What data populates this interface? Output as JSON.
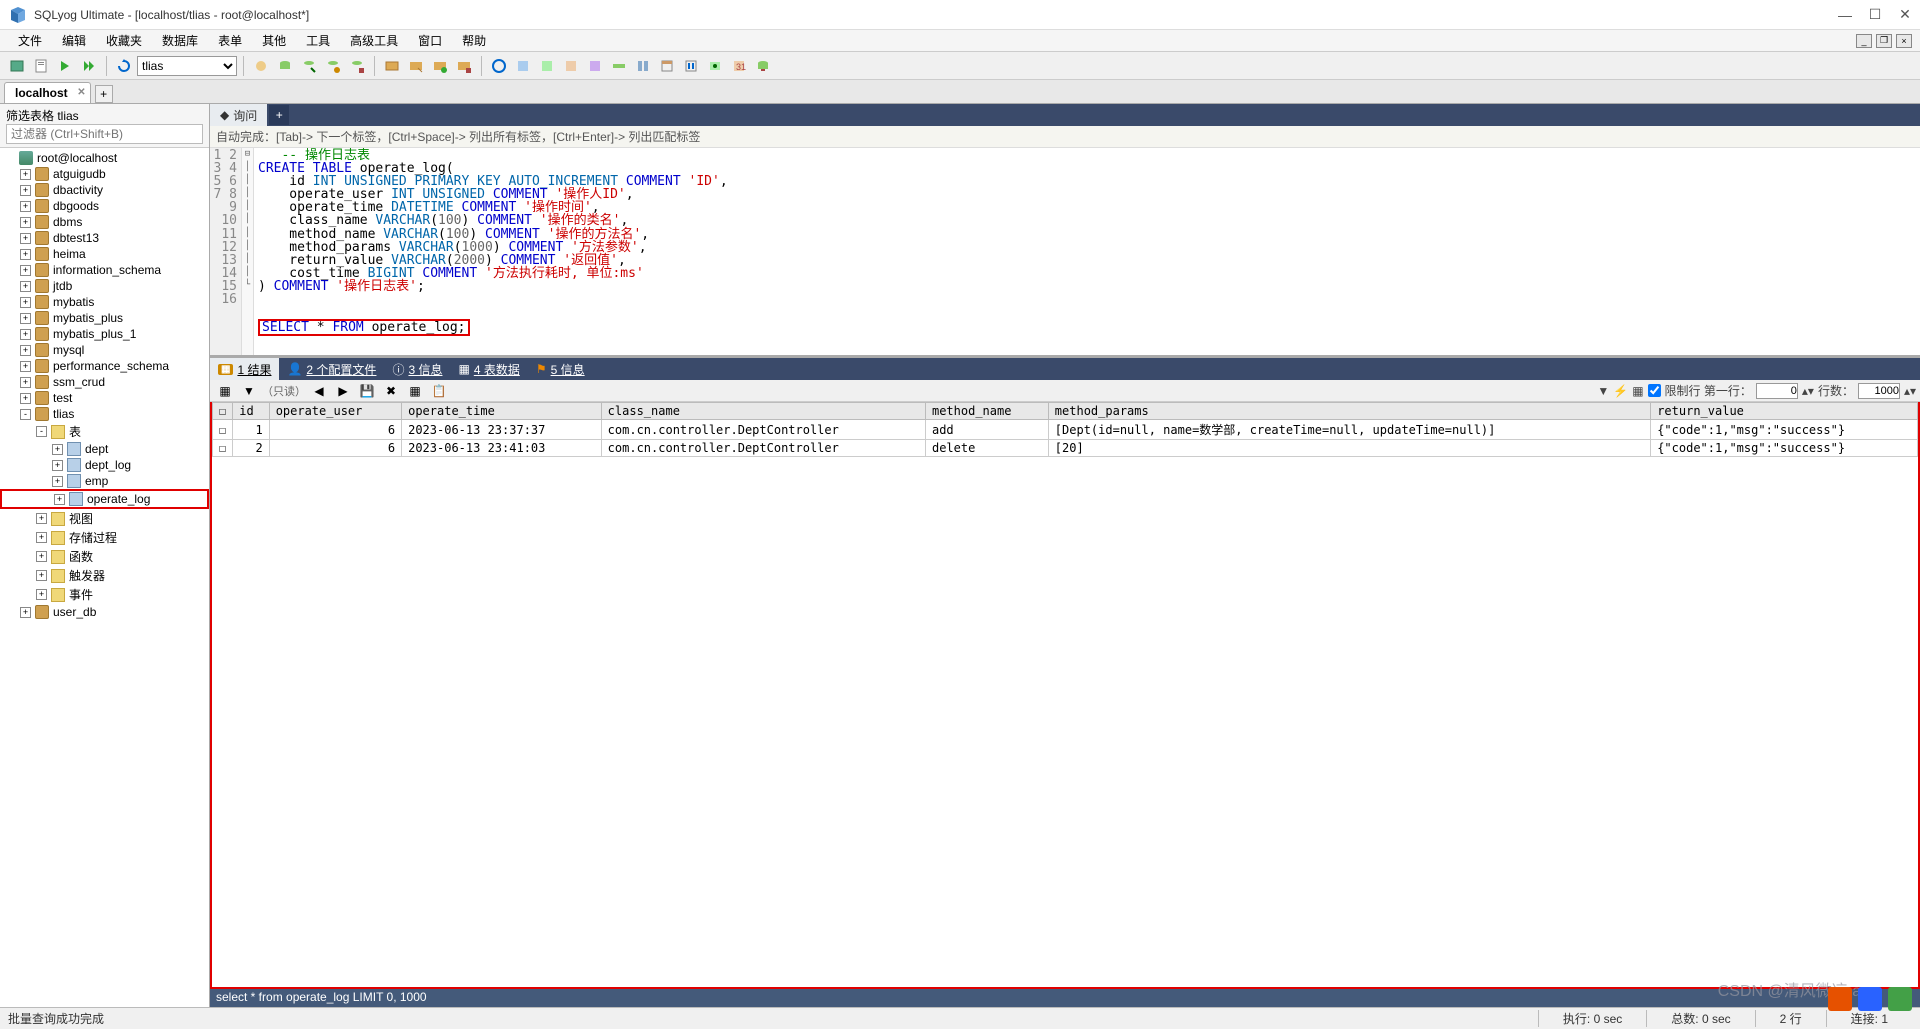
{
  "window": {
    "title": "SQLyog Ultimate - [localhost/tlias - root@localhost*]"
  },
  "menubar": [
    "文件",
    "编辑",
    "收藏夹",
    "数据库",
    "表单",
    "其他",
    "工具",
    "高级工具",
    "窗口",
    "帮助"
  ],
  "toolbar": {
    "db_selected": "tlias"
  },
  "conn_tab": "localhost",
  "sidebar": {
    "filter_label": "筛选表格 tlias",
    "filter_placeholder": "过滤器 (Ctrl+Shift+B)",
    "root": "root@localhost",
    "databases": [
      "atguigudb",
      "dbactivity",
      "dbgoods",
      "dbms",
      "dbtest13",
      "heima",
      "information_schema",
      "jtdb",
      "mybatis",
      "mybatis_plus",
      "mybatis_plus_1",
      "mysql",
      "performance_schema",
      "ssm_crud",
      "test"
    ],
    "current_db": "tlias",
    "tables_label": "表",
    "tables": [
      "dept",
      "dept_log",
      "emp",
      "operate_log"
    ],
    "folders": [
      "视图",
      "存储过程",
      "函数",
      "触发器",
      "事件"
    ],
    "last_db": "user_db"
  },
  "query": {
    "tab_label": "询问",
    "hint": "自动完成：[Tab]-> 下一个标签，[Ctrl+Space]-> 列出所有标签，[Ctrl+Enter]-> 列出匹配标签",
    "lines": 16
  },
  "result_tabs": {
    "t1": "1 结果",
    "t2": "2 个配置文件",
    "t3": "3 信息",
    "t4": "4 表数据",
    "t5": "5 信息"
  },
  "result_toolbar": {
    "readonly": "（只读）",
    "limit_label": "限制行 第一行：",
    "limit_first": "0",
    "rows_label": "行数：",
    "limit_rows": "1000"
  },
  "grid": {
    "columns": [
      "id",
      "operate_user",
      "operate_time",
      "class_name",
      "method_name",
      "method_params",
      "return_value"
    ],
    "rows": [
      {
        "id": "1",
        "operate_user": "6",
        "operate_time": "2023-06-13 23:37:37",
        "class_name": "com.cn.controller.DeptController",
        "method_name": "add",
        "method_params": "[Dept(id=null, name=数学部, createTime=null, updateTime=null)]",
        "return_value": "{\"code\":1,\"msg\":\"success\"}"
      },
      {
        "id": "2",
        "operate_user": "6",
        "operate_time": "2023-06-13 23:41:03",
        "class_name": "com.cn.controller.DeptController",
        "method_name": "delete",
        "method_params": "[20]",
        "return_value": "{\"code\":1,\"msg\":\"success\"}"
      }
    ]
  },
  "sql_footer": "select * from operate_log LIMIT 0, 1000",
  "statusbar": {
    "msg": "批量查询成功完成",
    "exec": "执行: 0 sec",
    "total": "总数: 0 sec",
    "rows": "2 行",
    "conn": "连接: 1"
  },
  "watermark": "CSDN @清风微凉 aa"
}
